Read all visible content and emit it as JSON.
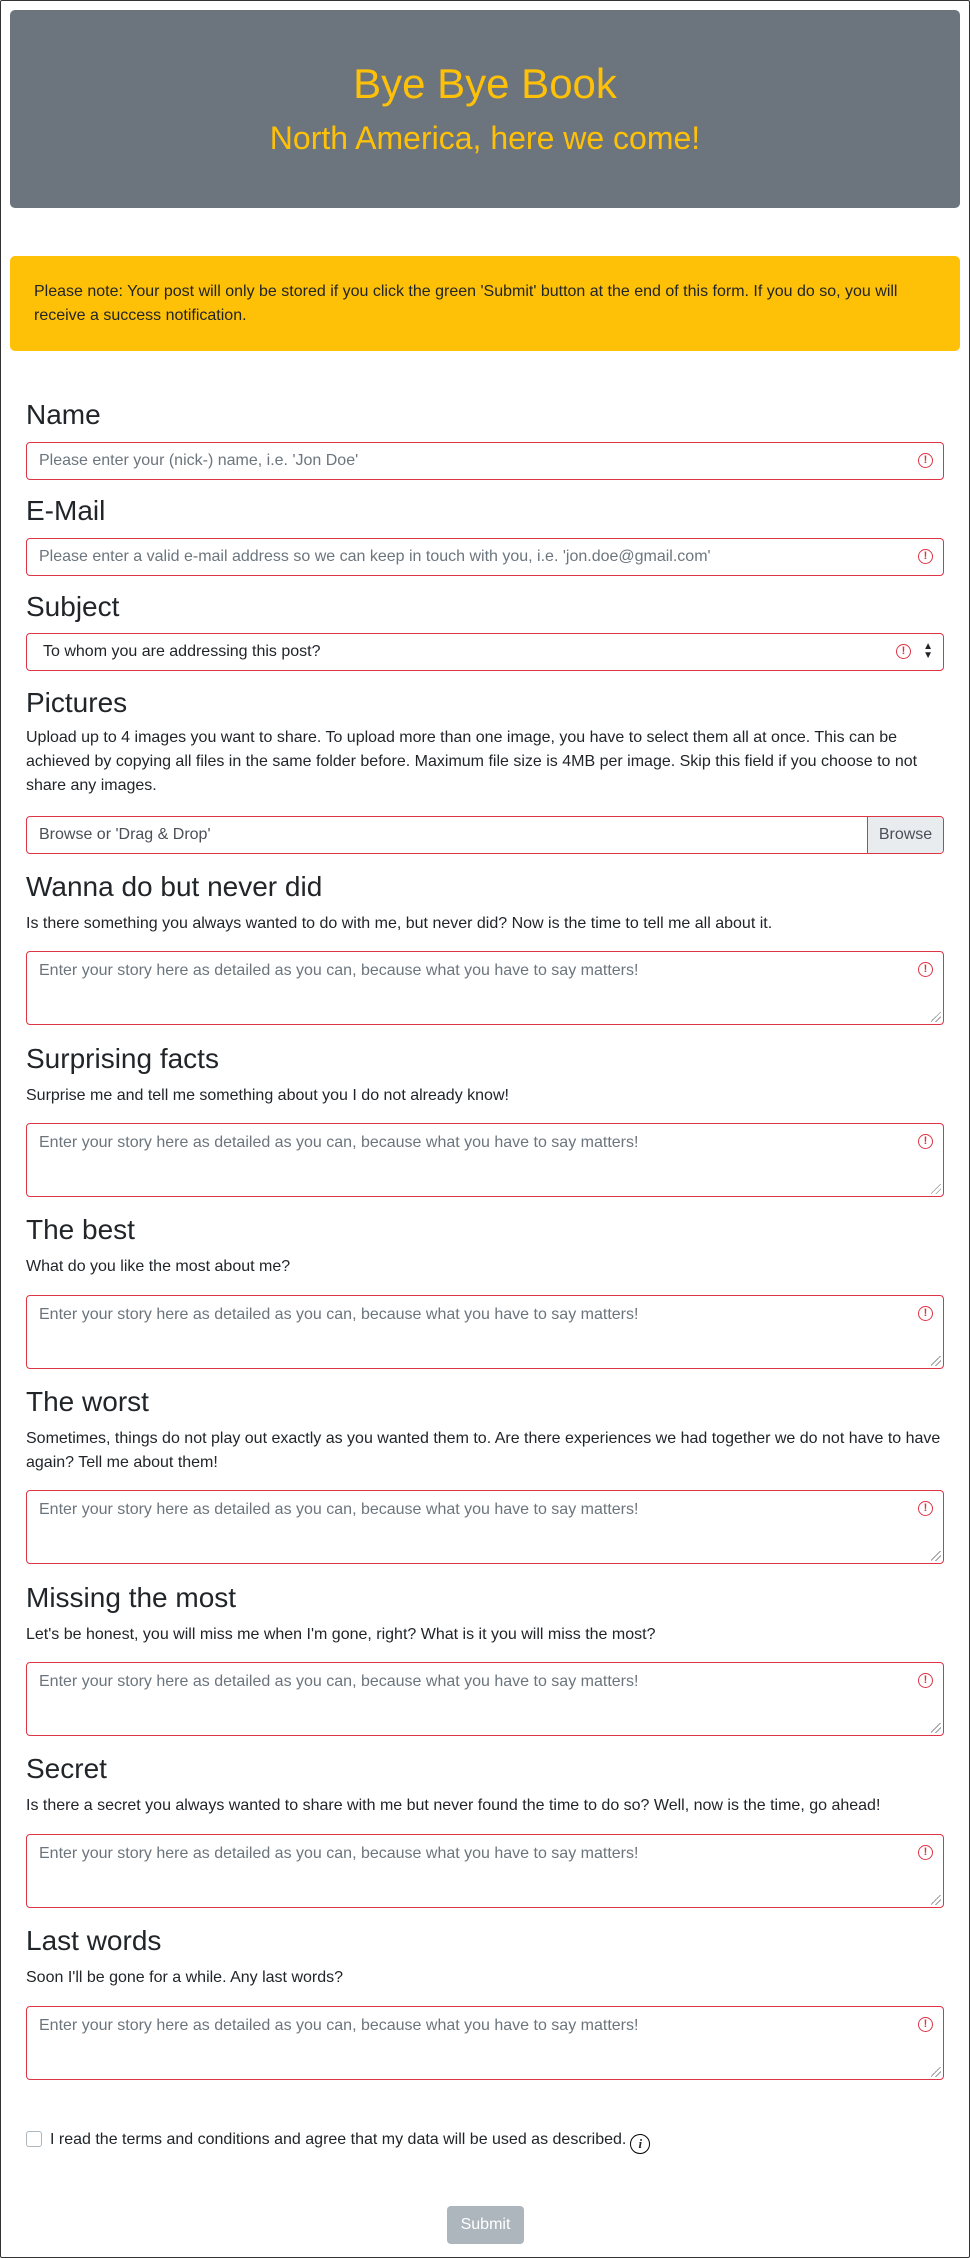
{
  "header": {
    "title": "Bye Bye Book",
    "subtitle": "North America, here we come!"
  },
  "notice": {
    "text": "Please note: Your post will only be stored if you click the green 'Submit' button at the end of this form. If you do so, you will receive a success notification."
  },
  "name": {
    "label": "Name",
    "placeholder": "Please enter your (nick-) name, i.e. 'Jon Doe'"
  },
  "email": {
    "label": "E-Mail",
    "placeholder": "Please enter a valid e-mail address so we can keep in touch with you, i.e. 'jon.doe@gmail.com'"
  },
  "subject": {
    "label": "Subject",
    "selected": "To whom you are addressing this post?"
  },
  "pictures": {
    "label": "Pictures",
    "description": "Upload up to 4 images you want to share. To upload more than one image, you have to select them all at once. This can be achieved by copying all files in the same folder before. Maximum file size is 4MB per image. Skip this field if you choose to not share any images.",
    "placeholder": "Browse or 'Drag & Drop'",
    "browse_label": "Browse"
  },
  "story_placeholder": "Enter your story here as detailed as you can, because what you have to say matters!",
  "sections": [
    {
      "label": "Wanna do but never did",
      "description": "Is there something you always wanted to do with me, but never did? Now is the time to tell me all about it."
    },
    {
      "label": "Surprising facts",
      "description": "Surprise me and tell me something about you I do not already know!"
    },
    {
      "label": "The best",
      "description": "What do you like the most about me?"
    },
    {
      "label": "The worst",
      "description": "Sometimes, things do not play out exactly as you wanted them to. Are there experiences we had together we do not have to have again? Tell me about them!"
    },
    {
      "label": "Missing the most",
      "description": "Let's be honest, you will miss me when I'm gone, right? What is it you will miss the most?"
    },
    {
      "label": "Secret",
      "description": "Is there a secret you always wanted to share with me but never found the time to do so? Well, now is the time, go ahead!"
    },
    {
      "label": "Last words",
      "description": "Soon I'll be gone for a while. Any last words?"
    }
  ],
  "terms": {
    "text": "I read the terms and conditions and agree that my data will be used as described."
  },
  "submit_label": "Submit",
  "colors": {
    "header_bg": "#6c757d",
    "accent": "#ffc107",
    "invalid": "#dc3545",
    "submit_disabled": "#adb5bd"
  }
}
